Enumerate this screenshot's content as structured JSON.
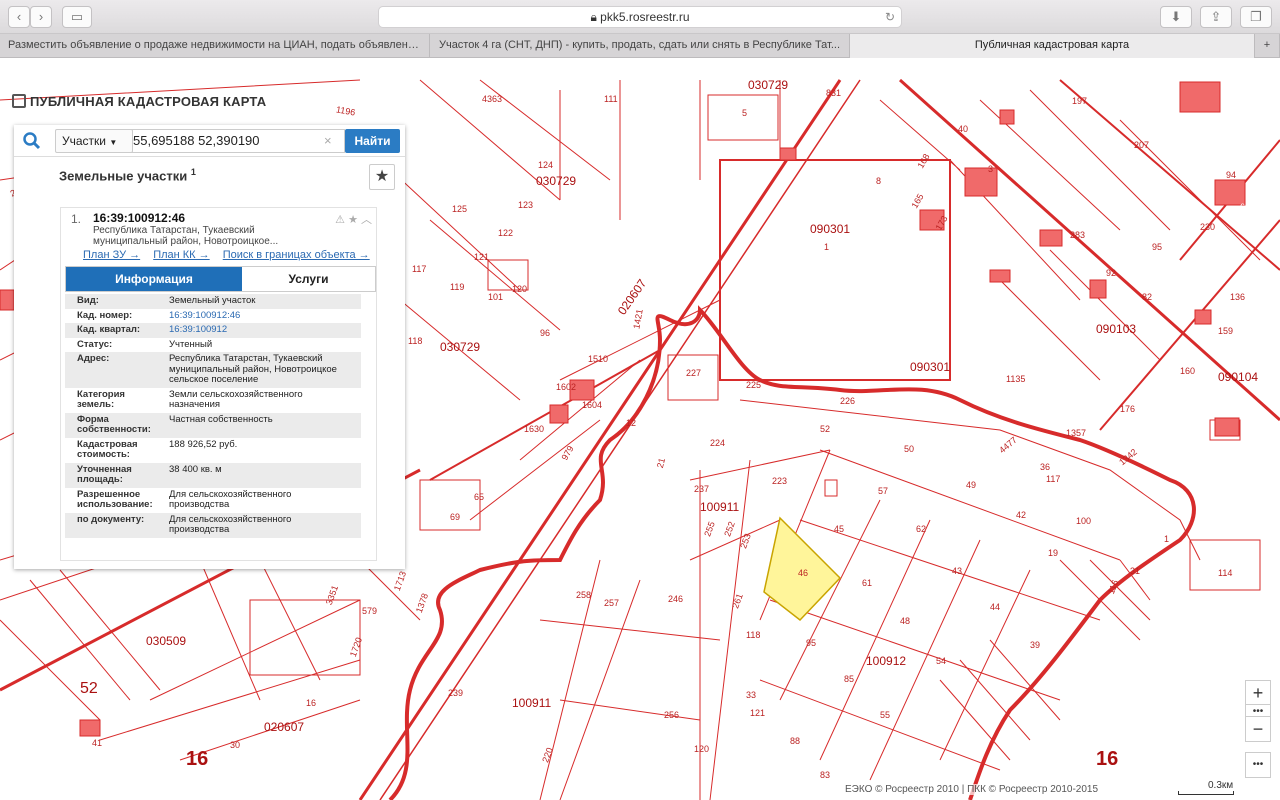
{
  "browser": {
    "url": "pkk5.rosreestr.ru",
    "tabs": [
      {
        "label": "Разместить объявление о продаже недвижимости на ЦИАН, подать объявлени..."
      },
      {
        "label": "Участок 4 га (СНТ, ДНП) - купить, продать, сдать или снять в Республике Тат..."
      },
      {
        "label": "Публичная кадастровая карта"
      }
    ]
  },
  "map": {
    "title": "ПУБЛИЧНАЯ КАДАСТРОВАЯ КАРТА",
    "labels": {
      "q030729a": "030729",
      "q030729b": "030729",
      "q030729c": "030729",
      "q090301a": "090301",
      "q090301b": "090301",
      "q020607a": "020607",
      "q020607b": "020607",
      "q090103": "090103",
      "q090104": "090104",
      "q100911a": "100911",
      "q100911b": "100911",
      "q100912": "100912",
      "q030509": "030509",
      "p4363": "4363",
      "p111": "111",
      "p124": "124",
      "p123": "123",
      "p125": "125",
      "p122": "122",
      "p121": "121",
      "p117": "117",
      "p119": "119",
      "p101": "101",
      "p120": "120",
      "p96": "96",
      "p118": "118",
      "p1": "1",
      "p5": "5",
      "p831": "831",
      "p197": "197",
      "p207": "207",
      "p40": "40",
      "p3": "3",
      "p283": "283",
      "p92": "92",
      "p82": "82",
      "p95": "95",
      "p63": "63",
      "p94": "94",
      "p230": "230",
      "p136": "136",
      "p159": "159",
      "p160": "160",
      "p1135": "1135",
      "p227": "227",
      "p225": "225",
      "p226": "226",
      "p224": "224",
      "p52": "52",
      "p50": "50",
      "p49": "49",
      "p4477": "4477",
      "p223": "223",
      "p57": "57",
      "p62": "62",
      "p42": "42",
      "p45": "45",
      "p46": "46",
      "p61": "61",
      "p43": "43",
      "p19": "19",
      "p48": "48",
      "p44": "44",
      "p95b": "95",
      "p118b": "118",
      "p39": "39",
      "p54": "54",
      "p85": "85",
      "p55": "55",
      "p88": "88",
      "p121b": "121",
      "p33": "33",
      "p120b": "120",
      "p83": "83",
      "p256": "256",
      "p246": "246",
      "p257": "257",
      "p258": "258",
      "p239": "239",
      "p69": "69",
      "p65": "65",
      "p579": "579",
      "p1630": "1630",
      "p979": "979",
      "p1602": "1602",
      "p1604": "1604",
      "p1510": "1510",
      "p1421": "1421",
      "p1357": "1357",
      "p117b": "117",
      "p36": "36",
      "p100": "100",
      "p1b": "1",
      "p114": "114",
      "p116": "116",
      "p31": "31",
      "p16a": "16",
      "p16b": "16",
      "p16c": "16",
      "p52b": "52",
      "p30": "30",
      "p41": "41",
      "p1196": "1196",
      "p232": "232",
      "p238": "238",
      "p1720": "1720",
      "p3351": "3351",
      "p1713": "1713",
      "p1378": "1378",
      "p237": "237",
      "p261": "261",
      "p253": "253",
      "p252": "252",
      "p255": "255",
      "p220": "220",
      "p21": "21",
      "p12": "12",
      "p1342": "1342",
      "p176": "176",
      "p165": "165",
      "p173": "173",
      "p8": "8",
      "p168": "168"
    },
    "copyright": "ЕЭКО © Росреестр 2010 | ПКК © Росреестр 2010-2015",
    "scale": "0.3км",
    "zoom_in": "+",
    "zoom_out": "−",
    "more": "•••",
    "selected_parcel_color": "#fff59a",
    "line_color": "#d72b2b"
  },
  "search": {
    "type_label": "Участки",
    "query": "55,695188 52,390190",
    "button": "Найти",
    "clear": "×"
  },
  "results": {
    "header": "Земельные участки",
    "header_count": "1",
    "item": {
      "index": "1.",
      "cadnum": "16:39:100912:46",
      "address_short": "Республика Татарстан, Тукаевский муниципальный район, Новотроицкое...",
      "links": [
        "План ЗУ →",
        "План КК →",
        "Поиск в границах объекта →"
      ],
      "tabs": [
        "Информация",
        "Услуги"
      ],
      "fields": [
        {
          "label": "Вид:",
          "value": "Земельный участок"
        },
        {
          "label": "Кад. номер:",
          "value": "16:39:100912:46",
          "link": true
        },
        {
          "label": "Кад. квартал:",
          "value": "16:39:100912",
          "link": true
        },
        {
          "label": "Статус:",
          "value": "Учтенный"
        },
        {
          "label": "Адрес:",
          "value": "Республика Татарстан, Тукаевский муниципальный район, Новотроицкое сельское поселение"
        },
        {
          "label": "Категория земель:",
          "value": "Земли сельскохозяйственного назначения"
        },
        {
          "label": "Форма собственности:",
          "value": "Частная собственность"
        },
        {
          "label": "Кадастровая стоимость:",
          "value": "188 926,52 руб."
        },
        {
          "label": "Уточненная площадь:",
          "value": "38 400 кв. м"
        },
        {
          "label": "Разрешенное использование:",
          "value": "Для сельскохозяйственного производства"
        },
        {
          "label": "по документу:",
          "value": "Для сельскохозяйственного производства"
        }
      ]
    }
  }
}
